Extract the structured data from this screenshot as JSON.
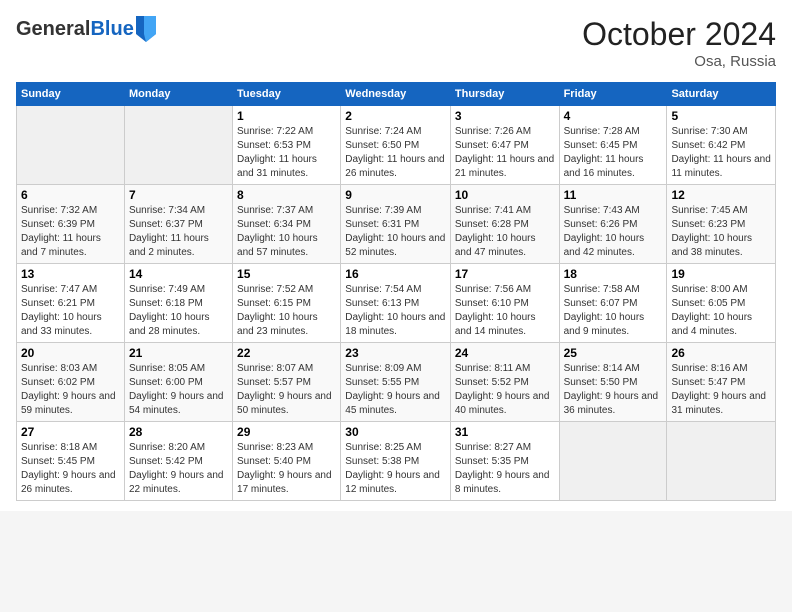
{
  "logo": {
    "general": "General",
    "blue": "Blue"
  },
  "header": {
    "month": "October 2024",
    "location": "Osa, Russia"
  },
  "weekdays": [
    "Sunday",
    "Monday",
    "Tuesday",
    "Wednesday",
    "Thursday",
    "Friday",
    "Saturday"
  ],
  "weeks": [
    [
      {
        "day": "",
        "sunrise": "",
        "sunset": "",
        "daylight": ""
      },
      {
        "day": "",
        "sunrise": "",
        "sunset": "",
        "daylight": ""
      },
      {
        "day": "1",
        "sunrise": "Sunrise: 7:22 AM",
        "sunset": "Sunset: 6:53 PM",
        "daylight": "Daylight: 11 hours and 31 minutes."
      },
      {
        "day": "2",
        "sunrise": "Sunrise: 7:24 AM",
        "sunset": "Sunset: 6:50 PM",
        "daylight": "Daylight: 11 hours and 26 minutes."
      },
      {
        "day": "3",
        "sunrise": "Sunrise: 7:26 AM",
        "sunset": "Sunset: 6:47 PM",
        "daylight": "Daylight: 11 hours and 21 minutes."
      },
      {
        "day": "4",
        "sunrise": "Sunrise: 7:28 AM",
        "sunset": "Sunset: 6:45 PM",
        "daylight": "Daylight: 11 hours and 16 minutes."
      },
      {
        "day": "5",
        "sunrise": "Sunrise: 7:30 AM",
        "sunset": "Sunset: 6:42 PM",
        "daylight": "Daylight: 11 hours and 11 minutes."
      }
    ],
    [
      {
        "day": "6",
        "sunrise": "Sunrise: 7:32 AM",
        "sunset": "Sunset: 6:39 PM",
        "daylight": "Daylight: 11 hours and 7 minutes."
      },
      {
        "day": "7",
        "sunrise": "Sunrise: 7:34 AM",
        "sunset": "Sunset: 6:37 PM",
        "daylight": "Daylight: 11 hours and 2 minutes."
      },
      {
        "day": "8",
        "sunrise": "Sunrise: 7:37 AM",
        "sunset": "Sunset: 6:34 PM",
        "daylight": "Daylight: 10 hours and 57 minutes."
      },
      {
        "day": "9",
        "sunrise": "Sunrise: 7:39 AM",
        "sunset": "Sunset: 6:31 PM",
        "daylight": "Daylight: 10 hours and 52 minutes."
      },
      {
        "day": "10",
        "sunrise": "Sunrise: 7:41 AM",
        "sunset": "Sunset: 6:28 PM",
        "daylight": "Daylight: 10 hours and 47 minutes."
      },
      {
        "day": "11",
        "sunrise": "Sunrise: 7:43 AM",
        "sunset": "Sunset: 6:26 PM",
        "daylight": "Daylight: 10 hours and 42 minutes."
      },
      {
        "day": "12",
        "sunrise": "Sunrise: 7:45 AM",
        "sunset": "Sunset: 6:23 PM",
        "daylight": "Daylight: 10 hours and 38 minutes."
      }
    ],
    [
      {
        "day": "13",
        "sunrise": "Sunrise: 7:47 AM",
        "sunset": "Sunset: 6:21 PM",
        "daylight": "Daylight: 10 hours and 33 minutes."
      },
      {
        "day": "14",
        "sunrise": "Sunrise: 7:49 AM",
        "sunset": "Sunset: 6:18 PM",
        "daylight": "Daylight: 10 hours and 28 minutes."
      },
      {
        "day": "15",
        "sunrise": "Sunrise: 7:52 AM",
        "sunset": "Sunset: 6:15 PM",
        "daylight": "Daylight: 10 hours and 23 minutes."
      },
      {
        "day": "16",
        "sunrise": "Sunrise: 7:54 AM",
        "sunset": "Sunset: 6:13 PM",
        "daylight": "Daylight: 10 hours and 18 minutes."
      },
      {
        "day": "17",
        "sunrise": "Sunrise: 7:56 AM",
        "sunset": "Sunset: 6:10 PM",
        "daylight": "Daylight: 10 hours and 14 minutes."
      },
      {
        "day": "18",
        "sunrise": "Sunrise: 7:58 AM",
        "sunset": "Sunset: 6:07 PM",
        "daylight": "Daylight: 10 hours and 9 minutes."
      },
      {
        "day": "19",
        "sunrise": "Sunrise: 8:00 AM",
        "sunset": "Sunset: 6:05 PM",
        "daylight": "Daylight: 10 hours and 4 minutes."
      }
    ],
    [
      {
        "day": "20",
        "sunrise": "Sunrise: 8:03 AM",
        "sunset": "Sunset: 6:02 PM",
        "daylight": "Daylight: 9 hours and 59 minutes."
      },
      {
        "day": "21",
        "sunrise": "Sunrise: 8:05 AM",
        "sunset": "Sunset: 6:00 PM",
        "daylight": "Daylight: 9 hours and 54 minutes."
      },
      {
        "day": "22",
        "sunrise": "Sunrise: 8:07 AM",
        "sunset": "Sunset: 5:57 PM",
        "daylight": "Daylight: 9 hours and 50 minutes."
      },
      {
        "day": "23",
        "sunrise": "Sunrise: 8:09 AM",
        "sunset": "Sunset: 5:55 PM",
        "daylight": "Daylight: 9 hours and 45 minutes."
      },
      {
        "day": "24",
        "sunrise": "Sunrise: 8:11 AM",
        "sunset": "Sunset: 5:52 PM",
        "daylight": "Daylight: 9 hours and 40 minutes."
      },
      {
        "day": "25",
        "sunrise": "Sunrise: 8:14 AM",
        "sunset": "Sunset: 5:50 PM",
        "daylight": "Daylight: 9 hours and 36 minutes."
      },
      {
        "day": "26",
        "sunrise": "Sunrise: 8:16 AM",
        "sunset": "Sunset: 5:47 PM",
        "daylight": "Daylight: 9 hours and 31 minutes."
      }
    ],
    [
      {
        "day": "27",
        "sunrise": "Sunrise: 8:18 AM",
        "sunset": "Sunset: 5:45 PM",
        "daylight": "Daylight: 9 hours and 26 minutes."
      },
      {
        "day": "28",
        "sunrise": "Sunrise: 8:20 AM",
        "sunset": "Sunset: 5:42 PM",
        "daylight": "Daylight: 9 hours and 22 minutes."
      },
      {
        "day": "29",
        "sunrise": "Sunrise: 8:23 AM",
        "sunset": "Sunset: 5:40 PM",
        "daylight": "Daylight: 9 hours and 17 minutes."
      },
      {
        "day": "30",
        "sunrise": "Sunrise: 8:25 AM",
        "sunset": "Sunset: 5:38 PM",
        "daylight": "Daylight: 9 hours and 12 minutes."
      },
      {
        "day": "31",
        "sunrise": "Sunrise: 8:27 AM",
        "sunset": "Sunset: 5:35 PM",
        "daylight": "Daylight: 9 hours and 8 minutes."
      },
      {
        "day": "",
        "sunrise": "",
        "sunset": "",
        "daylight": ""
      },
      {
        "day": "",
        "sunrise": "",
        "sunset": "",
        "daylight": ""
      }
    ]
  ]
}
